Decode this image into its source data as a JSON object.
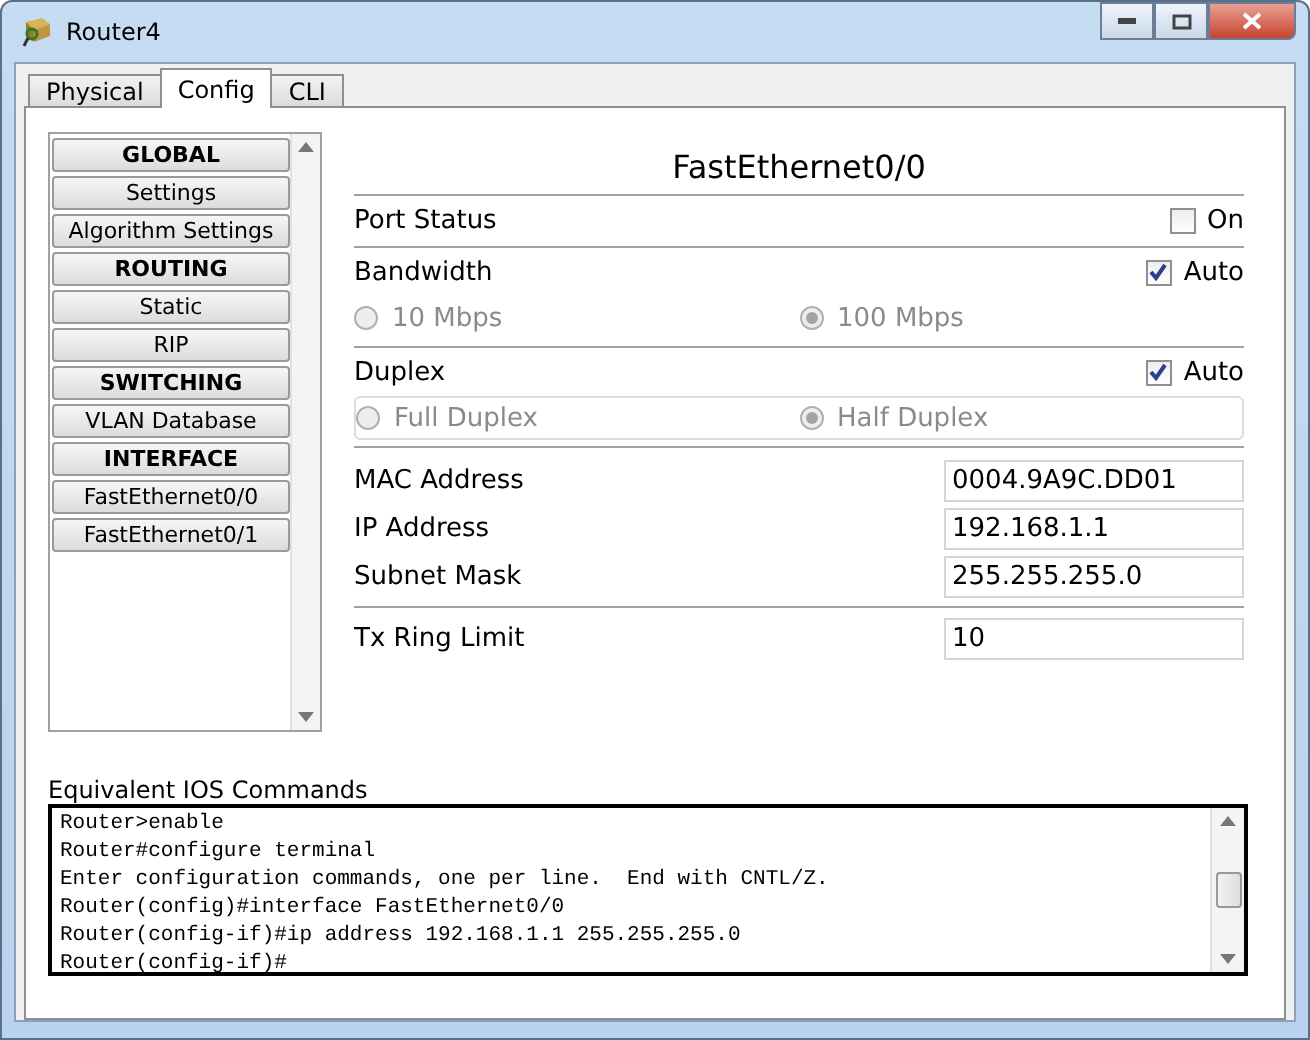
{
  "window": {
    "title": "Router4"
  },
  "tabs": [
    {
      "label": "Physical",
      "selected": false
    },
    {
      "label": "Config",
      "selected": true
    },
    {
      "label": "CLI",
      "selected": false
    }
  ],
  "sidebar": {
    "items": [
      {
        "label": "GLOBAL",
        "kind": "header"
      },
      {
        "label": "Settings",
        "kind": "item"
      },
      {
        "label": "Algorithm Settings",
        "kind": "item"
      },
      {
        "label": "ROUTING",
        "kind": "header"
      },
      {
        "label": "Static",
        "kind": "item"
      },
      {
        "label": "RIP",
        "kind": "item"
      },
      {
        "label": "SWITCHING",
        "kind": "header"
      },
      {
        "label": "VLAN Database",
        "kind": "item"
      },
      {
        "label": "INTERFACE",
        "kind": "header"
      },
      {
        "label": "FastEthernet0/0",
        "kind": "item"
      },
      {
        "label": "FastEthernet0/1",
        "kind": "item"
      }
    ]
  },
  "panel": {
    "title": "FastEthernet0/0",
    "port_status": {
      "label": "Port Status",
      "checkbox": {
        "label": "On",
        "checked": false
      }
    },
    "bandwidth": {
      "label": "Bandwidth",
      "auto": {
        "label": "Auto",
        "checked": true
      },
      "options": [
        {
          "label": "10 Mbps",
          "selected": false,
          "disabled": true
        },
        {
          "label": "100 Mbps",
          "selected": true,
          "disabled": true
        }
      ]
    },
    "duplex": {
      "label": "Duplex",
      "auto": {
        "label": "Auto",
        "checked": true
      },
      "options": [
        {
          "label": "Full Duplex",
          "selected": false,
          "disabled": true
        },
        {
          "label": "Half Duplex",
          "selected": true,
          "disabled": true
        }
      ]
    },
    "fields": [
      {
        "label": "MAC Address",
        "value": "0004.9A9C.DD01"
      },
      {
        "label": "IP Address",
        "value": "192.168.1.1"
      },
      {
        "label": "Subnet Mask",
        "value": "255.255.255.0"
      }
    ],
    "tx_ring": {
      "label": "Tx Ring Limit",
      "value": "10"
    }
  },
  "commands": {
    "label": "Equivalent IOS Commands",
    "lines": [
      "Router>enable",
      "Router#configure terminal",
      "Enter configuration commands, one per line.  End with CNTL/Z.",
      "Router(config)#interface FastEthernet0/0",
      "Router(config-if)#ip address 192.168.1.1 255.255.255.0",
      "Router(config-if)#"
    ]
  }
}
